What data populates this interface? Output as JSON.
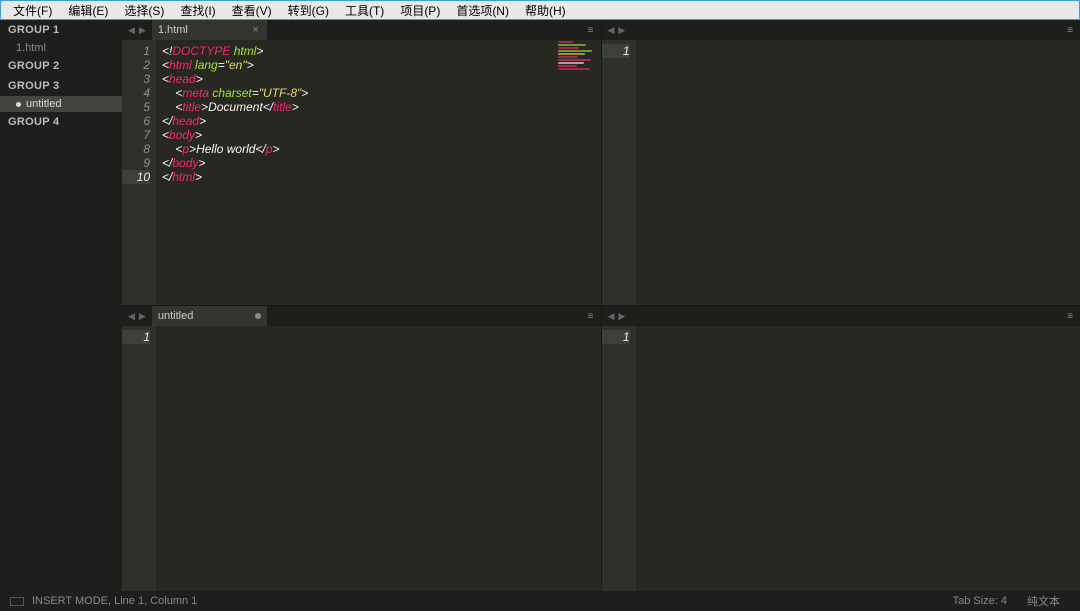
{
  "menubar": {
    "items": [
      "文件(F)",
      "编辑(E)",
      "选择(S)",
      "查找(I)",
      "查看(V)",
      "转到(G)",
      "工具(T)",
      "项目(P)",
      "首选项(N)",
      "帮助(H)"
    ]
  },
  "sidebar": {
    "groups": [
      {
        "label": "GROUP 1",
        "files": [
          {
            "name": "1.html",
            "modified": false,
            "selected": false
          }
        ]
      },
      {
        "label": "GROUP 2",
        "files": []
      },
      {
        "label": "GROUP 3",
        "files": [
          {
            "name": "untitled",
            "modified": true,
            "selected": true
          }
        ]
      },
      {
        "label": "GROUP 4",
        "files": []
      }
    ]
  },
  "panes": [
    {
      "tabs": [
        {
          "label": "1.html",
          "modified": false,
          "active": true
        }
      ],
      "gutter_current": 10,
      "lines": [
        [
          [
            "punc",
            "<!"
          ],
          [
            "keyword",
            "DOCTYPE"
          ],
          [
            "text",
            " "
          ],
          [
            "attr",
            "html"
          ],
          [
            "punc",
            ">"
          ]
        ],
        [
          [
            "punc",
            "<"
          ],
          [
            "tag",
            "html"
          ],
          [
            "text",
            " "
          ],
          [
            "attr",
            "lang"
          ],
          [
            "punc",
            "="
          ],
          [
            "string",
            "\"en\""
          ],
          [
            "punc",
            ">"
          ]
        ],
        [
          [
            "punc",
            "<"
          ],
          [
            "tag",
            "head"
          ],
          [
            "punc",
            ">"
          ]
        ],
        [
          [
            "text",
            "    "
          ],
          [
            "punc",
            "<"
          ],
          [
            "tag",
            "meta"
          ],
          [
            "text",
            " "
          ],
          [
            "attr",
            "charset"
          ],
          [
            "punc",
            "="
          ],
          [
            "string",
            "\"UTF-8\""
          ],
          [
            "punc",
            ">"
          ]
        ],
        [
          [
            "text",
            "    "
          ],
          [
            "punc",
            "<"
          ],
          [
            "tag",
            "title"
          ],
          [
            "punc",
            ">"
          ],
          [
            "text",
            "Document"
          ],
          [
            "punc",
            "</"
          ],
          [
            "tag",
            "title"
          ],
          [
            "punc",
            ">"
          ]
        ],
        [
          [
            "punc",
            "</"
          ],
          [
            "tag",
            "head"
          ],
          [
            "punc",
            ">"
          ]
        ],
        [
          [
            "punc",
            "<"
          ],
          [
            "tag",
            "body"
          ],
          [
            "punc",
            ">"
          ]
        ],
        [
          [
            "text",
            "    "
          ],
          [
            "punc",
            "<"
          ],
          [
            "tag",
            "p"
          ],
          [
            "punc",
            ">"
          ],
          [
            "text",
            "Hello world"
          ],
          [
            "punc",
            "</"
          ],
          [
            "tag",
            "p"
          ],
          [
            "punc",
            ">"
          ]
        ],
        [
          [
            "punc",
            "</"
          ],
          [
            "tag",
            "body"
          ],
          [
            "punc",
            ">"
          ]
        ],
        [
          [
            "punc",
            "</"
          ],
          [
            "tag",
            "html"
          ],
          [
            "punc",
            ">"
          ]
        ]
      ]
    },
    {
      "tabs": [],
      "gutter_current": 1,
      "lines": [
        []
      ]
    },
    {
      "tabs": [
        {
          "label": "untitled",
          "modified": true,
          "active": true
        }
      ],
      "gutter_current": 1,
      "lines": [
        []
      ]
    },
    {
      "tabs": [],
      "gutter_current": 1,
      "lines": [
        []
      ]
    }
  ],
  "statusbar": {
    "mode": "INSERT MODE, Line 1, Column 1",
    "tab_size": "Tab Size: 4",
    "syntax": "纯文本"
  },
  "glyphs": {
    "arrow_left": "◀",
    "arrow_right": "▶",
    "close": "×",
    "more": "≡"
  }
}
